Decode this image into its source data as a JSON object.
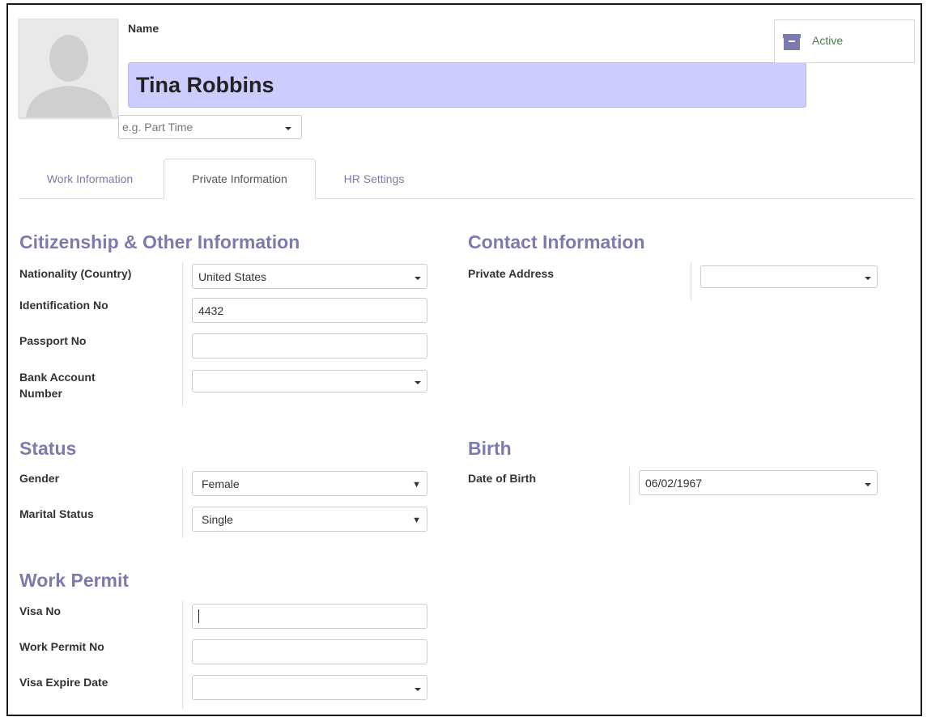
{
  "header": {
    "name_label": "Name",
    "name_value": "Tina Robbins",
    "category_placeholder": "e.g. Part Time",
    "active_label": "Active"
  },
  "tabs": [
    {
      "label": "Work Information",
      "active": false
    },
    {
      "label": "Private Information",
      "active": true
    },
    {
      "label": "HR Settings",
      "active": false
    }
  ],
  "citizenship": {
    "title": "Citizenship & Other Information",
    "nationality_label": "Nationality (Country)",
    "nationality_value": "United States",
    "identification_label": "Identification No",
    "identification_value": "4432",
    "passport_label": "Passport No",
    "passport_value": "",
    "bank_label_line1": "Bank Account",
    "bank_label_line2": "Number",
    "bank_value": ""
  },
  "contact": {
    "title": "Contact Information",
    "private_address_label": "Private Address",
    "private_address_value": ""
  },
  "status": {
    "title": "Status",
    "gender_label": "Gender",
    "gender_value": "Female",
    "marital_label": "Marital Status",
    "marital_value": "Single"
  },
  "birth": {
    "title": "Birth",
    "dob_label": "Date of Birth",
    "dob_value": "06/02/1967"
  },
  "work_permit": {
    "title": "Work Permit",
    "visa_no_label": "Visa No",
    "visa_no_value": "",
    "permit_no_label": "Work Permit No",
    "permit_no_value": "",
    "visa_expire_label": "Visa Expire Date",
    "visa_expire_value": ""
  },
  "colors": {
    "accent": "#7c7bad",
    "name_field_bg": "#ccccff",
    "active_text": "#4c7d4c"
  },
  "icons": {
    "avatar": "person-silhouette-icon",
    "active": "archive-icon"
  }
}
